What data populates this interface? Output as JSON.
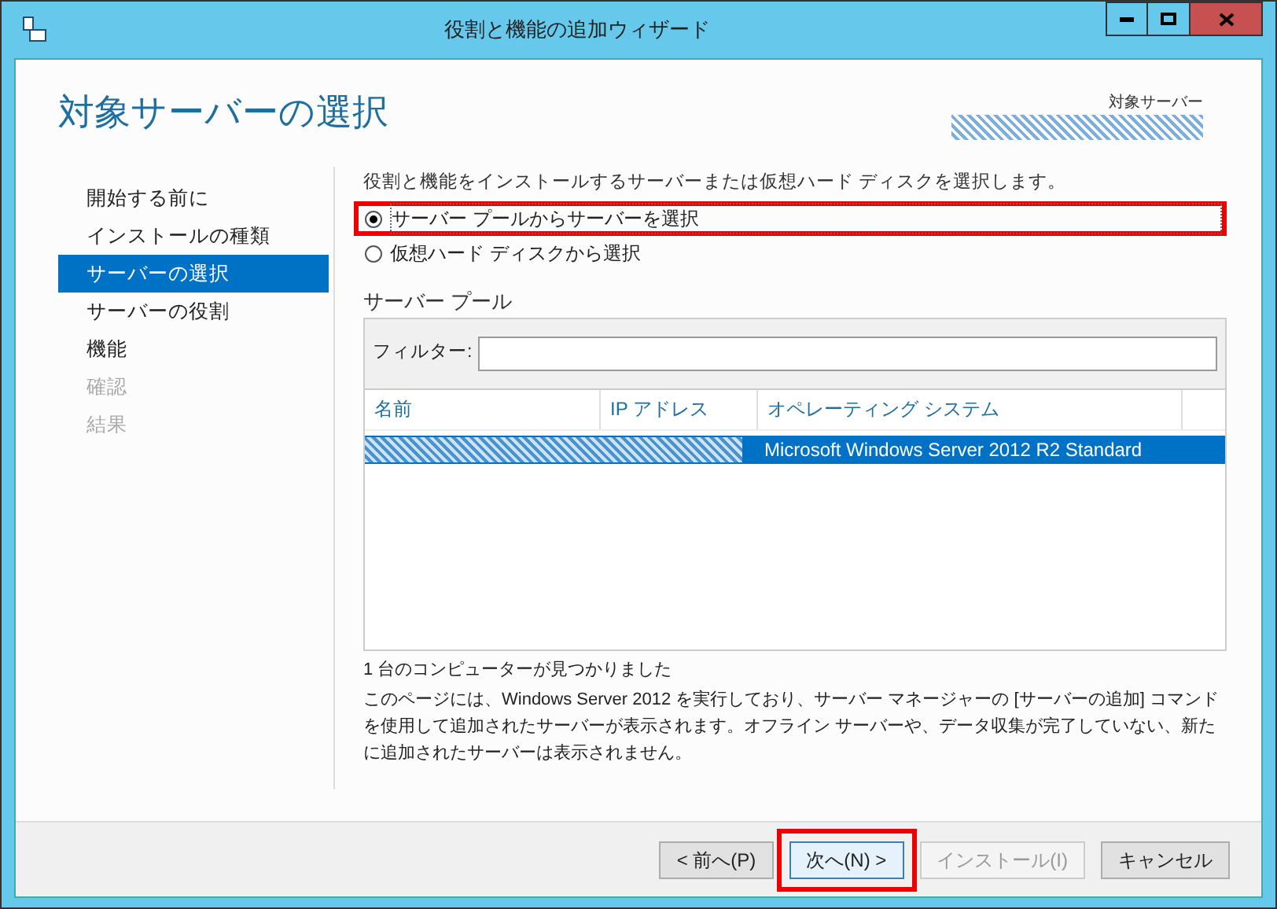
{
  "window": {
    "title": "役割と機能の追加ウィザード"
  },
  "header": {
    "title": "対象サーバーの選択",
    "target_label": "対象サーバー"
  },
  "sidebar": {
    "items": [
      {
        "label": "開始する前に",
        "selected": false,
        "disabled": false
      },
      {
        "label": "インストールの種類",
        "selected": false,
        "disabled": false
      },
      {
        "label": "サーバーの選択",
        "selected": true,
        "disabled": false
      },
      {
        "label": "サーバーの役割",
        "selected": false,
        "disabled": false
      },
      {
        "label": "機能",
        "selected": false,
        "disabled": false
      },
      {
        "label": "確認",
        "selected": false,
        "disabled": true
      },
      {
        "label": "結果",
        "selected": false,
        "disabled": true
      }
    ]
  },
  "description": "役割と機能をインストールするサーバーまたは仮想ハード ディスクを選択します。",
  "options": [
    {
      "label": "サーバー プールからサーバーを選択",
      "selected": true,
      "highlighted": true
    },
    {
      "label": "仮想ハード ディスクから選択",
      "selected": false,
      "highlighted": false
    }
  ],
  "server_pool": {
    "title": "サーバー プール",
    "filter_label": "フィルター:",
    "columns": [
      "名前",
      "IP アドレス",
      "オペレーティング システム"
    ],
    "rows": [
      {
        "os": "Microsoft Windows Server 2012 R2 Standard",
        "selected": true
      }
    ],
    "count": "1 台のコンピューターが見つかりました",
    "note": "このページには、Windows Server 2012 を実行しており、サーバー マネージャーの [サーバーの追加] コマンドを使用して追加されたサーバーが表示されます。オフライン サーバーや、データ収集が完了していない、新たに追加されたサーバーは表示されません。"
  },
  "buttons": [
    {
      "label": "< 前へ(P)",
      "disabled": false,
      "highlighted": false
    },
    {
      "label": "次へ(N) >",
      "disabled": false,
      "highlighted": true
    },
    {
      "label": "インストール(I)",
      "disabled": true,
      "highlighted": false
    },
    {
      "label": "キャンセル",
      "disabled": false,
      "highlighted": false
    }
  ]
}
